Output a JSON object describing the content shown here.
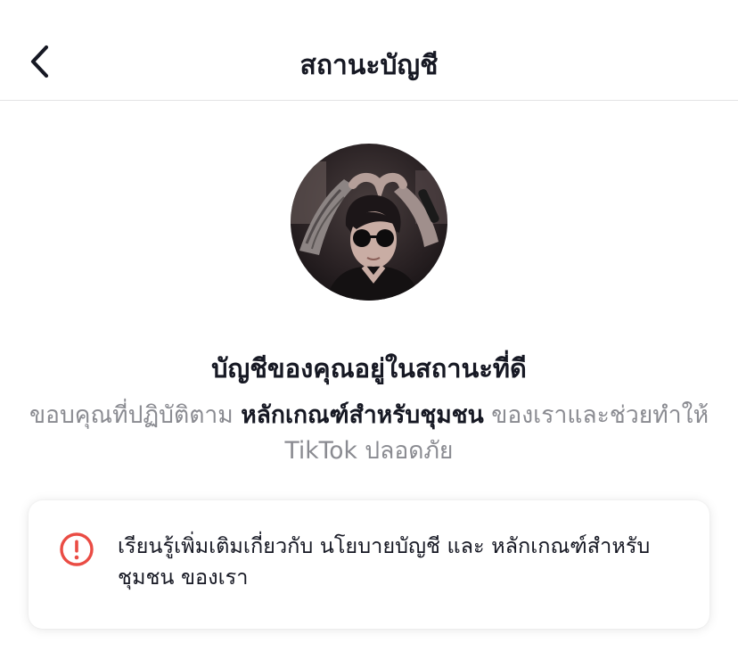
{
  "header": {
    "title": "สถานะบัญชี",
    "back_icon": "chevron-left-icon"
  },
  "avatar": {
    "icon": "profile-photo"
  },
  "status": {
    "title": "บัญชีของคุณอยู่ในสถานะที่ดี",
    "desc_before": "ขอบคุณที่ปฏิบัติตาม ",
    "desc_link": "หลักเกณฑ์สำหรับชุมชน",
    "desc_after": " ของเราและช่วยทำให้ TikTok ปลอดภัย"
  },
  "info_card": {
    "icon": "exclamation-circle-icon",
    "text_before": "เรียนรู้เพิ่มเติมเกี่ยวกับ ",
    "link_policy": "นโยบายบัญชี",
    "text_and": " และ ",
    "link_guidelines": "หลักเกณฑ์สำหรับชุมชน",
    "text_after": " ของเรา"
  },
  "colors": {
    "primary_text": "#161823",
    "secondary_text": "#8a8b91",
    "alert_red": "#ea4c44",
    "divider": "#e3e3e4"
  }
}
